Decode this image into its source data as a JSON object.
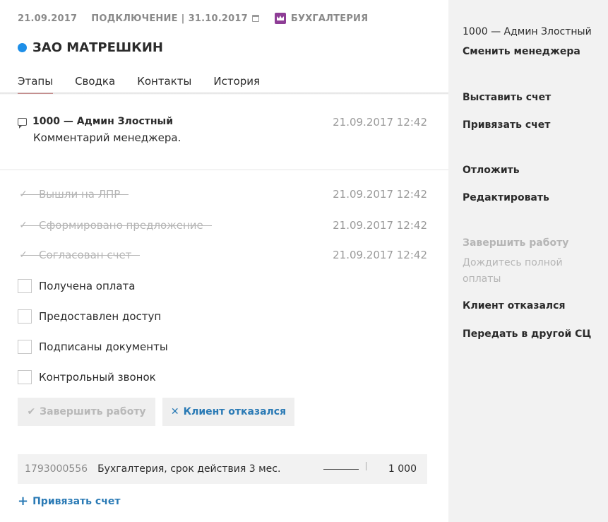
{
  "header": {
    "date": "21.09.2017",
    "connection_label": "ПОДКЛЮЧЕНИЕ",
    "separator": "|",
    "connection_date": "31.10.2017",
    "department": "БУХГАЛТЕРИЯ",
    "company_name": "ЗАО МАТРЕШКИН"
  },
  "tabs": [
    {
      "label": "Этапы"
    },
    {
      "label": "Сводка"
    },
    {
      "label": "Контакты"
    },
    {
      "label": "История"
    }
  ],
  "comment": {
    "author": "1000 — Админ Злостный",
    "time": "21.09.2017 12:42",
    "text": "Комментарий менеджера."
  },
  "stages_done": [
    {
      "label": "Вышли на ЛПР",
      "time": "21.09.2017 12:42"
    },
    {
      "label": "Сформировано предложение",
      "time": "21.09.2017 12:42"
    },
    {
      "label": "Согласован счет",
      "time": "21.09.2017 12:42"
    }
  ],
  "stages_todo": [
    {
      "label": "Получена оплата"
    },
    {
      "label": "Предоставлен доступ"
    },
    {
      "label": "Подписаны документы"
    },
    {
      "label": "Контрольный звонок"
    }
  ],
  "buttons": {
    "finish": "Завершить работу",
    "refuse": "Клиент отказался"
  },
  "invoice": {
    "number": "1793000556",
    "description": "Бухгалтерия, срок действия 3 мес.",
    "amount": "1 000"
  },
  "attach_link": "Привязать счет",
  "sidebar": {
    "manager": "1000 — Админ Злостный",
    "change_manager": "Сменить менеджера",
    "issue_invoice": "Выставить счет",
    "attach_invoice": "Привязать счет",
    "postpone": "Отложить",
    "edit": "Редактировать",
    "finish_work": "Завершить работу",
    "finish_hint": "Дождитесь полной оплаты",
    "client_refused": "Клиент отказался",
    "transfer": "Передать в другой СЦ"
  },
  "colors": {
    "status_dot": "#1e8fe8",
    "department_icon": "#8e3d96",
    "link": "#2a7ab5",
    "active_tab_underline": "#b03a3a"
  }
}
